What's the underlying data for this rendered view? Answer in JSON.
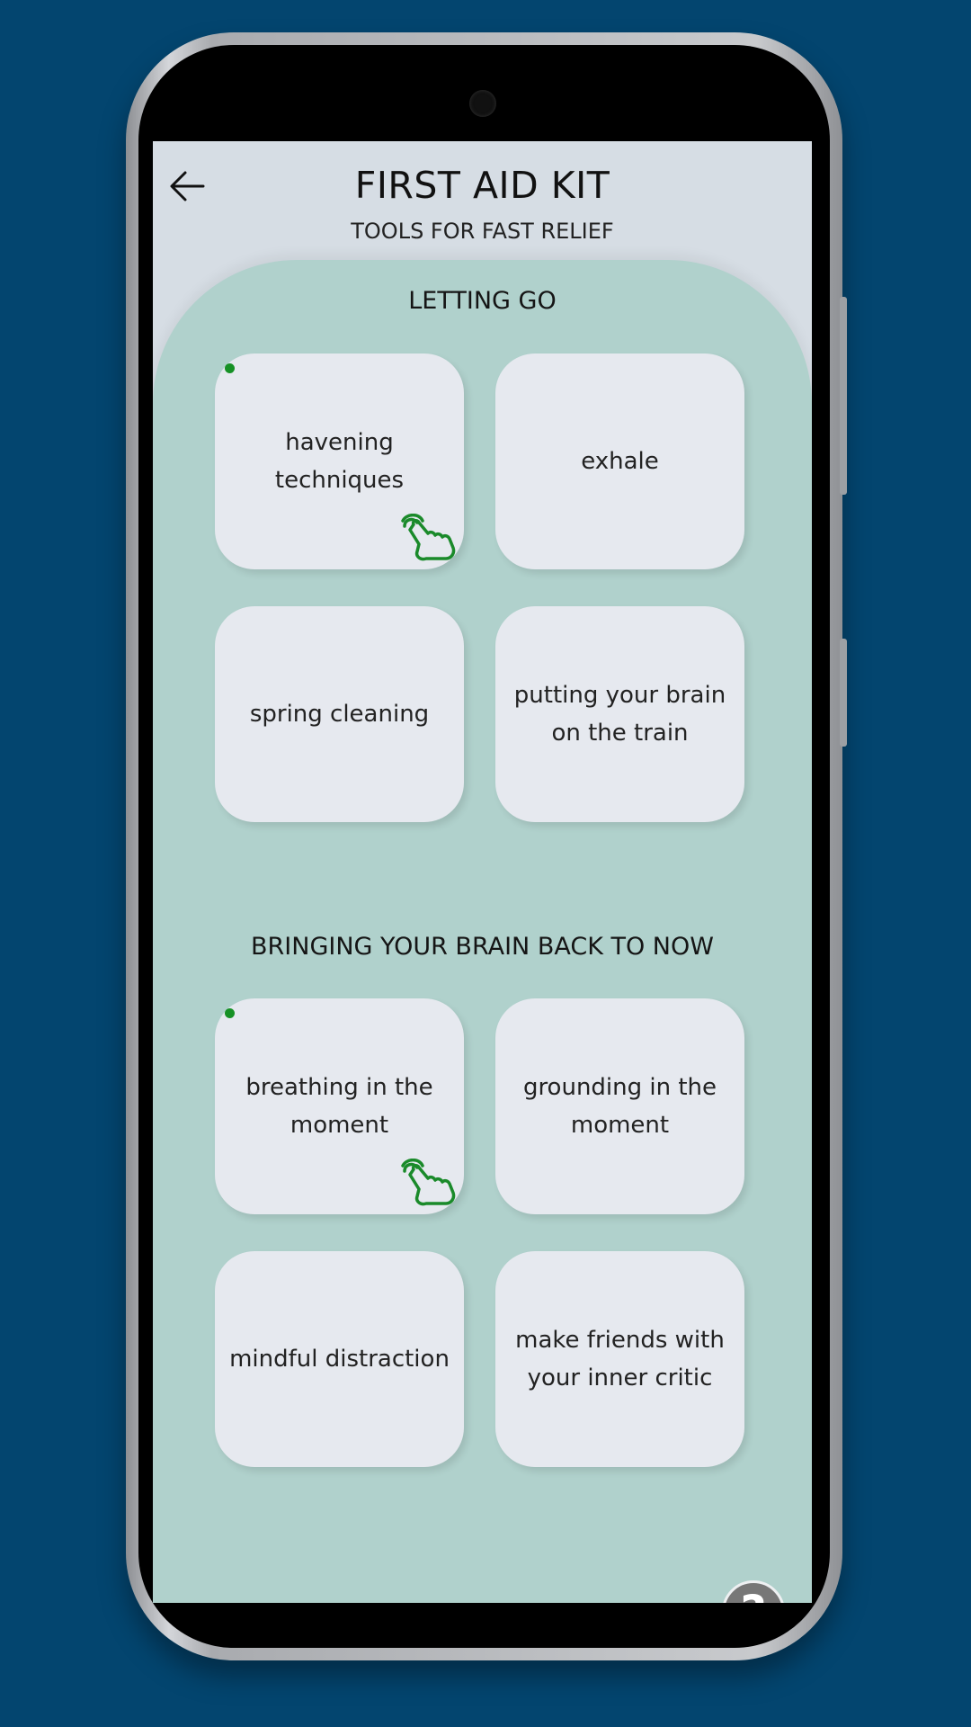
{
  "header": {
    "back_icon": "arrow-left-icon",
    "title": "FIRST AID KIT",
    "subtitle": "TOOLS FOR FAST RELIEF"
  },
  "sections": [
    {
      "title": "LETTING GO",
      "tools": [
        {
          "label": "havening techniques",
          "new_dot": true,
          "tap_hint": true
        },
        {
          "label": "exhale",
          "new_dot": false,
          "tap_hint": false
        },
        {
          "label": "spring cleaning",
          "new_dot": false,
          "tap_hint": false
        },
        {
          "label": "putting your brain on the train",
          "new_dot": false,
          "tap_hint": false
        }
      ]
    },
    {
      "title": "BRINGING YOUR BRAIN BACK TO NOW",
      "tools": [
        {
          "label": "breathing in the moment",
          "new_dot": true,
          "tap_hint": true
        },
        {
          "label": "grounding in the moment",
          "new_dot": false,
          "tap_hint": false
        },
        {
          "label": "mindful distraction",
          "new_dot": false,
          "tap_hint": false
        },
        {
          "label": "make friends with your inner critic",
          "new_dot": false,
          "tap_hint": false
        }
      ]
    }
  ],
  "help": {
    "glyph": "?",
    "icon": "question-mark-icon"
  },
  "colors": {
    "background": "#03456f",
    "screen": "#d6dde4",
    "panel": "#b0d1cc",
    "card": "#e6e9ef",
    "accent_green": "#169125",
    "help_button": "#777777"
  }
}
